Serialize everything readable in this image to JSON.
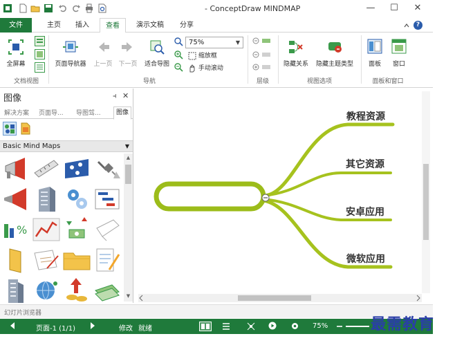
{
  "window": {
    "title": "- ConceptDraw MINDMAP",
    "controls": [
      "—",
      "☐",
      "✕"
    ]
  },
  "tabs": [
    {
      "label": "文件",
      "name": "file"
    },
    {
      "label": "主页",
      "name": "home"
    },
    {
      "label": "插入",
      "name": "insert"
    },
    {
      "label": "查看",
      "name": "view"
    },
    {
      "label": "演示文稿",
      "name": "presentation"
    },
    {
      "label": "分享",
      "name": "share"
    }
  ],
  "active_tab": "查看",
  "ribbon": {
    "fullscreen": "全屏幕",
    "page_navigator": "页面导航器",
    "prev_page": "上一页",
    "next_page": "下一页",
    "fit_map": "适合导图",
    "zoom_value": "75%",
    "zoom_box": "缩放框",
    "hand_scroll": "手动滚动",
    "hide_relations": "隐藏关系",
    "hide_topic_types": "隐藏主题类型",
    "panel": "面板",
    "window": "窗口",
    "groups": {
      "doc_view": "文档视图",
      "navigation": "导航",
      "levels": "层级",
      "view_options": "视图选项",
      "panels_windows": "面板和窗口"
    }
  },
  "left_panel": {
    "title": "图像",
    "pin": "⫞",
    "close": "✕",
    "tabs": [
      "解决方案",
      "页面导...",
      "导图驾...",
      "图像"
    ],
    "library": "Basic Mind Maps"
  },
  "map": {
    "branches": [
      "教程资源",
      "其它资源",
      "安卓应用",
      "微软应用"
    ],
    "branch_color": "#a6c21e"
  },
  "slide_browser": "幻灯片浏览器",
  "status": {
    "page": "页面-1 (1/1)",
    "modified": "修改",
    "ready": "就绪",
    "zoom": "75%"
  },
  "watermark": "最需教育",
  "colors": {
    "accent": "#1f7a3b",
    "branch": "#a6c21e"
  }
}
